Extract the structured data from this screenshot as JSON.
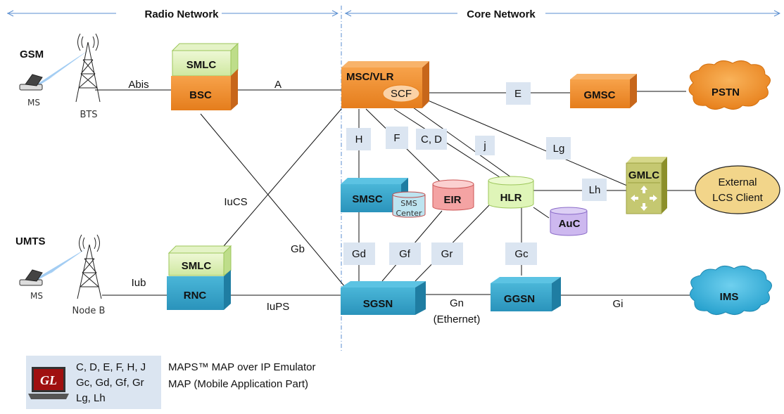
{
  "sections": {
    "radio": "Radio Network",
    "core": "Core Network"
  },
  "access": {
    "gsm": {
      "title": "GSM",
      "ms": "MS",
      "tower": "BTS"
    },
    "umts": {
      "title": "UMTS",
      "ms": "MS",
      "tower": "Node B"
    }
  },
  "nodes": {
    "smlc_top": "SMLC",
    "bsc": "BSC",
    "smlc_bottom": "SMLC",
    "rnc": "RNC",
    "msc": "MSC/VLR",
    "scf": "SCF",
    "gmsc": "GMSC",
    "pstn": "PSTN",
    "smsc": "SMSC",
    "sms_center_1": "SMS",
    "sms_center_2": "Center",
    "eir": "EIR",
    "hlr": "HLR",
    "auc": "AuC",
    "gmlc": "GMLC",
    "lcs_1": "External",
    "lcs_2": "LCS Client",
    "sgsn": "SGSN",
    "ggsn": "GGSN",
    "ims": "IMS"
  },
  "interfaces": {
    "abis": "Abis",
    "a": "A",
    "iub": "Iub",
    "iucs": "IuCS",
    "iups": "IuPS",
    "gb": "Gb",
    "e": "E",
    "h": "H",
    "f": "F",
    "cd": "C, D",
    "j": "j",
    "lg": "Lg",
    "lh": "Lh",
    "gd": "Gd",
    "gf": "Gf",
    "gr": "Gr",
    "gc": "Gc",
    "gn_1": "Gn",
    "gn_2": "(Ethernet)",
    "gi": "Gi"
  },
  "legend": {
    "logo": "GL",
    "line1": "C, D, E, F, H, J",
    "line2": "Gc, Gd, Gf, Gr",
    "line3": "Lg, Lh",
    "title1": "MAPS™ MAP over IP Emulator",
    "title2": "MAP (Mobile Application Part)"
  }
}
